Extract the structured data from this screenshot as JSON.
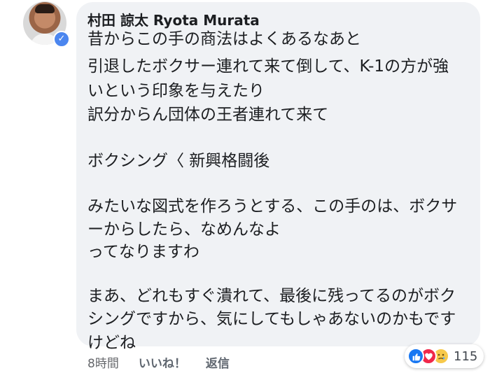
{
  "comment": {
    "author": "村田 諒太 Ryota Murata",
    "lines": [
      "昔からこの手の商法はよくあるなあと",
      "引退したボクサー連れて来て倒して、K-1の方が強",
      "いという印象を与えたり",
      "訳分からん団体の王者連れて来て",
      "ボクシング〈 新興格闘後",
      "みたいな図式を作ろうとする、この手のは、ボクサ",
      "ーからしたら、なめんなよ",
      "ってなりますわ",
      "まあ、どれもすぐ潰れて、最後に残ってるのがボク",
      "シングですから、気にしてもしゃあないのかもです",
      "けどね"
    ],
    "time": "8時間",
    "like_label": "いいね！",
    "reply_label": "返信",
    "reaction_count": "115",
    "reaction_icons": [
      "like-icon",
      "love-icon",
      "sad-icon"
    ],
    "colors": {
      "bubble": "#f0f2f5",
      "like": "#1877f2",
      "love": "#f0284a",
      "sad": "#f7c94b",
      "verified": "#4b86ef"
    }
  }
}
